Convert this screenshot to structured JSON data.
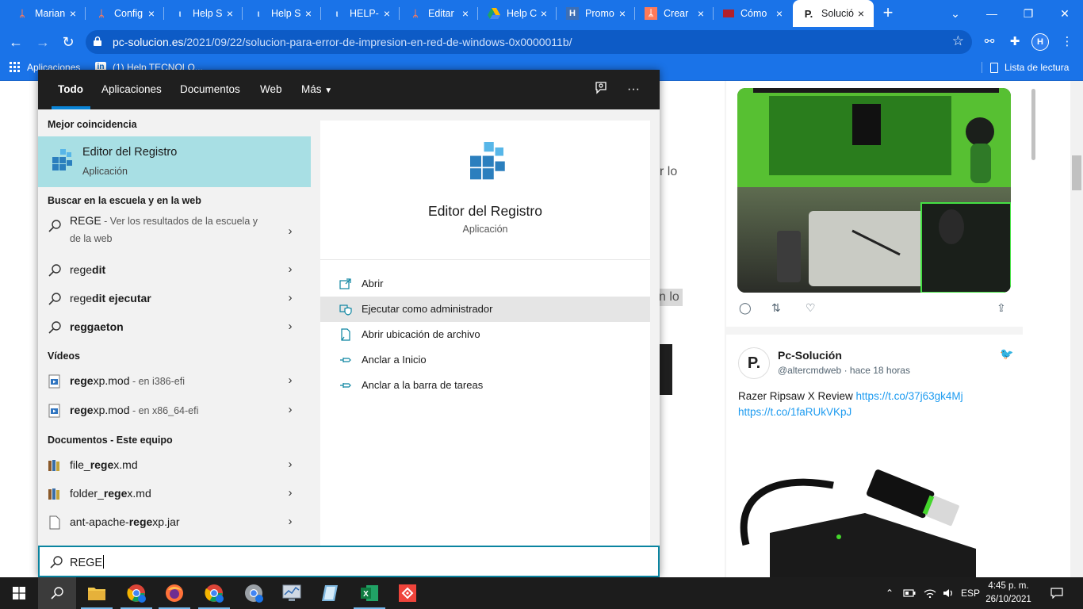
{
  "browser": {
    "tabs": [
      {
        "title": "Marian",
        "icon": "hubspot-icon"
      },
      {
        "title": "Config",
        "icon": "hubspot-icon"
      },
      {
        "title": "Help S",
        "icon": "helpdesk-icon"
      },
      {
        "title": "Help S",
        "icon": "helpdesk-icon"
      },
      {
        "title": "HELP-",
        "icon": "helpdesk-icon"
      },
      {
        "title": "Editar",
        "icon": "hubspot-icon"
      },
      {
        "title": "Help C",
        "icon": "google-drive-icon"
      },
      {
        "title": "Promo",
        "icon": "h-square-icon"
      },
      {
        "title": "Crear",
        "icon": "hubspot-icon"
      },
      {
        "title": "Cómo",
        "icon": "red-site-icon"
      },
      {
        "title": "Solució",
        "icon": "pc-solucion-icon",
        "active": true
      }
    ],
    "url_host": "pc-solucion.es",
    "url_path": "/2021/09/22/solucion-para-error-de-impresion-en-red-de-windows-0x0000011b/",
    "profile_initial": "H",
    "bookmarks": {
      "apps": "Aplicaciones",
      "linkedin": "(1) Help TECNOLO...",
      "reading_list": "Lista de lectura"
    }
  },
  "page": {
    "text_frag_1": "r  lo",
    "text_frag_2": "n lo",
    "tweet": {
      "name": "Pc-Solución",
      "handle": "@altercmdweb",
      "time": "· hace 18 horas",
      "text": "Razer Ripsaw X Review ",
      "link1": "https://t.co/37j63gk4Mj",
      "link2": "https://t.co/1faRUkVKpJ",
      "avatar_letter": "P."
    }
  },
  "search": {
    "tabs": [
      "Todo",
      "Aplicaciones",
      "Documentos",
      "Web",
      "Más"
    ],
    "best_match_header": "Mejor coincidencia",
    "best_match": {
      "title": "Editor del Registro",
      "subtitle": "Aplicación"
    },
    "web_header": "Buscar en la escuela y en la web",
    "web_results": [
      {
        "bold": "",
        "text": "REGE",
        "meta": " - Ver los resultados de la escuela y de la web"
      },
      {
        "pre": "rege",
        "bold": "dit",
        "meta": ""
      },
      {
        "pre": "rege",
        "bold": "dit ejecutar",
        "meta": ""
      },
      {
        "pre": "",
        "bold": "reggaeton",
        "meta": ""
      }
    ],
    "videos_header": "Vídeos",
    "videos": [
      {
        "pre": "rege",
        "rest": "xp.mod",
        "meta": " - en i386-efi"
      },
      {
        "pre": "rege",
        "rest": "xp.mod",
        "meta": " - en x86_64-efi"
      }
    ],
    "docs_header": "Documentos - Este equipo",
    "docs": [
      {
        "pre": "file_",
        "mid": "rege",
        "rest": "x.md"
      },
      {
        "pre": "folder_",
        "mid": "rege",
        "rest": "x.md"
      },
      {
        "pre": "ant-apache-",
        "mid": "rege",
        "rest": "xp.jar"
      }
    ],
    "preview": {
      "title": "Editor del Registro",
      "subtitle": "Aplicación",
      "actions": [
        "Abrir",
        "Ejecutar como administrador",
        "Abrir ubicación de archivo",
        "Anclar a Inicio",
        "Anclar a la barra de tareas"
      ]
    },
    "query": "REGE"
  },
  "taskbar": {
    "language": "ESP",
    "time": "4:45 p. m.",
    "date": "26/10/2021"
  },
  "colors": {
    "chrome_blue": "#1a73e8",
    "best_match_bg": "#a8dfe4",
    "search_accent": "#0a84a0",
    "taskbar": "#1c1c1c"
  }
}
